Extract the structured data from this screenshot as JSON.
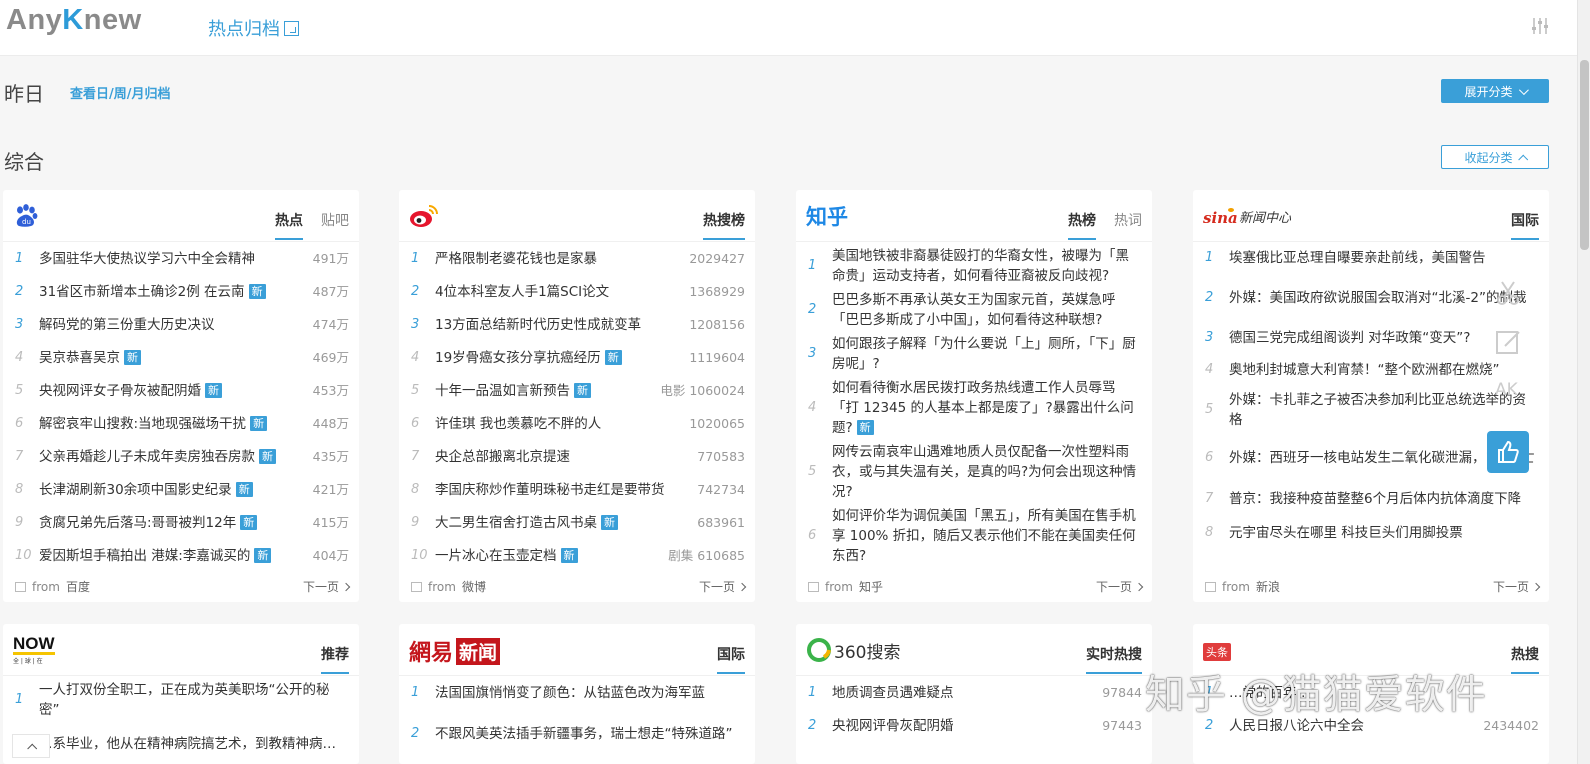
{
  "header": {
    "logo_part1": "Any",
    "logo_part2": "K",
    "logo_part3": "new",
    "archive_label": "热点归档"
  },
  "date_row": {
    "title": "昨日",
    "sub_link": "查看日/周/月归档",
    "expand_label": "展开分类"
  },
  "section": {
    "title": "综合",
    "collapse_label": "收起分类"
  },
  "cards": [
    {
      "tabs": [
        "热点",
        "贴吧"
      ],
      "items": [
        {
          "rank": "1",
          "title": "多国驻华大使热议学习六中全会精神",
          "hot": "491万",
          "new": ""
        },
        {
          "rank": "2",
          "title": "31省区市新增本土确诊2例 在云南",
          "hot": "487万",
          "new": "新"
        },
        {
          "rank": "3",
          "title": "解码党的第三份重大历史决议",
          "hot": "474万",
          "new": ""
        },
        {
          "rank": "4",
          "title": "吴京恭喜吴京",
          "hot": "469万",
          "new": "新"
        },
        {
          "rank": "5",
          "title": "央视网评女子骨灰被配阴婚",
          "hot": "453万",
          "new": "新"
        },
        {
          "rank": "6",
          "title": "解密哀牢山搜救:当地现强磁场干扰",
          "hot": "448万",
          "new": "新"
        },
        {
          "rank": "7",
          "title": "父亲再婚趁儿子未成年卖房独吞房款",
          "hot": "435万",
          "new": "新"
        },
        {
          "rank": "8",
          "title": "长津湖刷新30余项中国影史纪录",
          "hot": "421万",
          "new": "新"
        },
        {
          "rank": "9",
          "title": "贪腐兄弟先后落马:哥哥被判12年",
          "hot": "415万",
          "new": "新"
        },
        {
          "rank": "10",
          "title": "爱因斯坦手稿拍出 港媒:李嘉诚买的",
          "hot": "404万",
          "new": "新"
        }
      ],
      "from_label": "from",
      "source": "百度",
      "next_label": "下一页"
    },
    {
      "tabs": [
        "热搜榜"
      ],
      "items": [
        {
          "rank": "1",
          "title": "严格限制老婆花钱也是家暴",
          "hot": "2029427",
          "new": ""
        },
        {
          "rank": "2",
          "title": "4位本科室友人手1篇SCI论文",
          "hot": "1368929",
          "new": ""
        },
        {
          "rank": "3",
          "title": "13方面总结新时代历史性成就变革",
          "hot": "1208156",
          "new": ""
        },
        {
          "rank": "4",
          "title": "19岁骨癌女孩分享抗癌经历",
          "hot": "1119604",
          "new": "新"
        },
        {
          "rank": "5",
          "title": "十年一品温如言新预告",
          "hot": "电影 1060024",
          "new": "新"
        },
        {
          "rank": "6",
          "title": "许佳琪 我也羡慕吃不胖的人",
          "hot": "1020065",
          "new": ""
        },
        {
          "rank": "7",
          "title": "央企总部搬离北京提速",
          "hot": "770583",
          "new": ""
        },
        {
          "rank": "8",
          "title": "李国庆称炒作董明珠秘书走红是要带货",
          "hot": "742734",
          "new": ""
        },
        {
          "rank": "9",
          "title": "大二男生宿舍打造古风书桌",
          "hot": "683961",
          "new": "新"
        },
        {
          "rank": "10",
          "title": "一片冰心在玉壶定档",
          "hot": "剧集 610685",
          "new": "新"
        }
      ],
      "from_label": "from",
      "source": "微博",
      "next_label": "下一页"
    },
    {
      "logo_text": "知乎",
      "tabs": [
        "热榜",
        "热词"
      ],
      "items": [
        {
          "rank": "1",
          "title": "美国地铁被非裔暴徒殴打的华裔女性，被曝为「黑命贵」运动支持者，如何看待亚裔被反向歧视?",
          "hot": "",
          "new": ""
        },
        {
          "rank": "2",
          "title": "巴巴多斯不再承认英女王为国家元首，英媒急呼「巴巴多斯成了小中国」，如何看待这种联想?",
          "hot": "",
          "new": ""
        },
        {
          "rank": "3",
          "title": "如何跟孩子解释「为什么要说「上」厕所，「下」厨房呢」?",
          "hot": "",
          "new": ""
        },
        {
          "rank": "4",
          "title": "如何看待衡水居民拨打政务热线遭工作人员辱骂「打 12345 的人基本上都是废了」?暴露出什么问题?",
          "hot": "",
          "new": "新"
        },
        {
          "rank": "5",
          "title": "网传云南哀牢山遇难地质人员仅配备一次性塑料雨衣，或与其失温有关，是真的吗?为何会出现这种情况?",
          "hot": "",
          "new": ""
        },
        {
          "rank": "6",
          "title": "如何评价华为调侃美国「黑五」，所有美国在售手机享 100% 折扣，随后又表示他们不能在美国卖任何东西?",
          "hot": "",
          "new": ""
        }
      ],
      "from_label": "from",
      "source": "知乎",
      "next_label": "下一页"
    },
    {
      "logo_text": "新闻中心",
      "tabs": [
        "国际"
      ],
      "items": [
        {
          "rank": "1",
          "title": "埃塞俄比亚总理自曝要亲赴前线，美国警告",
          "hot": "",
          "new": ""
        },
        {
          "rank": "2",
          "title": "外媒：美国政府欲说服国会取消对“北溪-2”的制裁",
          "hot": "",
          "new": ""
        },
        {
          "rank": "3",
          "title": "德国三党完成组阁谈判 对华政策“变天”?",
          "hot": "",
          "new": ""
        },
        {
          "rank": "4",
          "title": "奥地利封城意大利宵禁！“整个欧洲都在燃烧”",
          "hot": "",
          "new": ""
        },
        {
          "rank": "5",
          "title": "外媒：卡扎菲之子被否决参加利比亚总统选举的资格",
          "hot": "",
          "new": ""
        },
        {
          "rank": "6",
          "title": "外媒：西班牙一核电站发生二氧化碳泄漏，1人死亡",
          "hot": "",
          "new": ""
        },
        {
          "rank": "7",
          "title": "普京：我接种疫苗整整6个月后体内抗体滴度下降",
          "hot": "",
          "new": ""
        },
        {
          "rank": "8",
          "title": "元宇宙尽头在哪里 科技巨头们用脚投票",
          "hot": "",
          "new": ""
        }
      ],
      "from_label": "from",
      "source": "新浪",
      "next_label": "下一页"
    },
    {
      "logo_text": "NOW",
      "logo_sub": "全 | 球 | 在",
      "tabs": [
        "推荐"
      ],
      "items": [
        {
          "rank": "1",
          "title": "一人打双份全职工，正在成为英美职场“公开的秘密”",
          "hot": "",
          "new": ""
        },
        {
          "rank": "2",
          "title": "…系毕业，他从在精神病院搞艺术，到教精神病…",
          "hot": "",
          "new": ""
        }
      ]
    },
    {
      "logo_text1": "網易",
      "logo_text2": "新闻",
      "tabs": [
        "国际"
      ],
      "items": [
        {
          "rank": "1",
          "title": "法国国旗悄悄变了颜色：从钴蓝色改为海军蓝",
          "hot": "",
          "new": ""
        },
        {
          "rank": "2",
          "title": "不跟风美英法插手新疆事务，瑞士想走“特殊道路”",
          "hot": "",
          "new": ""
        }
      ]
    },
    {
      "logo_text": "360搜索",
      "tabs": [
        "实时热搜"
      ],
      "items": [
        {
          "rank": "1",
          "title": "地质调查员遇难疑点",
          "hot": "97844",
          "new": ""
        },
        {
          "rank": "2",
          "title": "央视网评骨灰配阴婚",
          "hot": "97443",
          "new": ""
        }
      ]
    },
    {
      "logo_text": "头条",
      "tabs": [
        "热搜"
      ],
      "items": [
        {
          "rank": "1",
          "title": "…党的百年…",
          "hot": "",
          "new": ""
        },
        {
          "rank": "2",
          "title": "人民日报八论六中全会",
          "hot": "2434402",
          "new": ""
        }
      ]
    }
  ],
  "side_tools": {
    "ak_label": "AK"
  },
  "watermark": "知乎 @猫猫爱软件",
  "colors": {
    "accent": "#3a9fd8",
    "sina_red": "#d52b1e",
    "netease_red": "#c4161c",
    "green_360": "#3bb34a"
  }
}
